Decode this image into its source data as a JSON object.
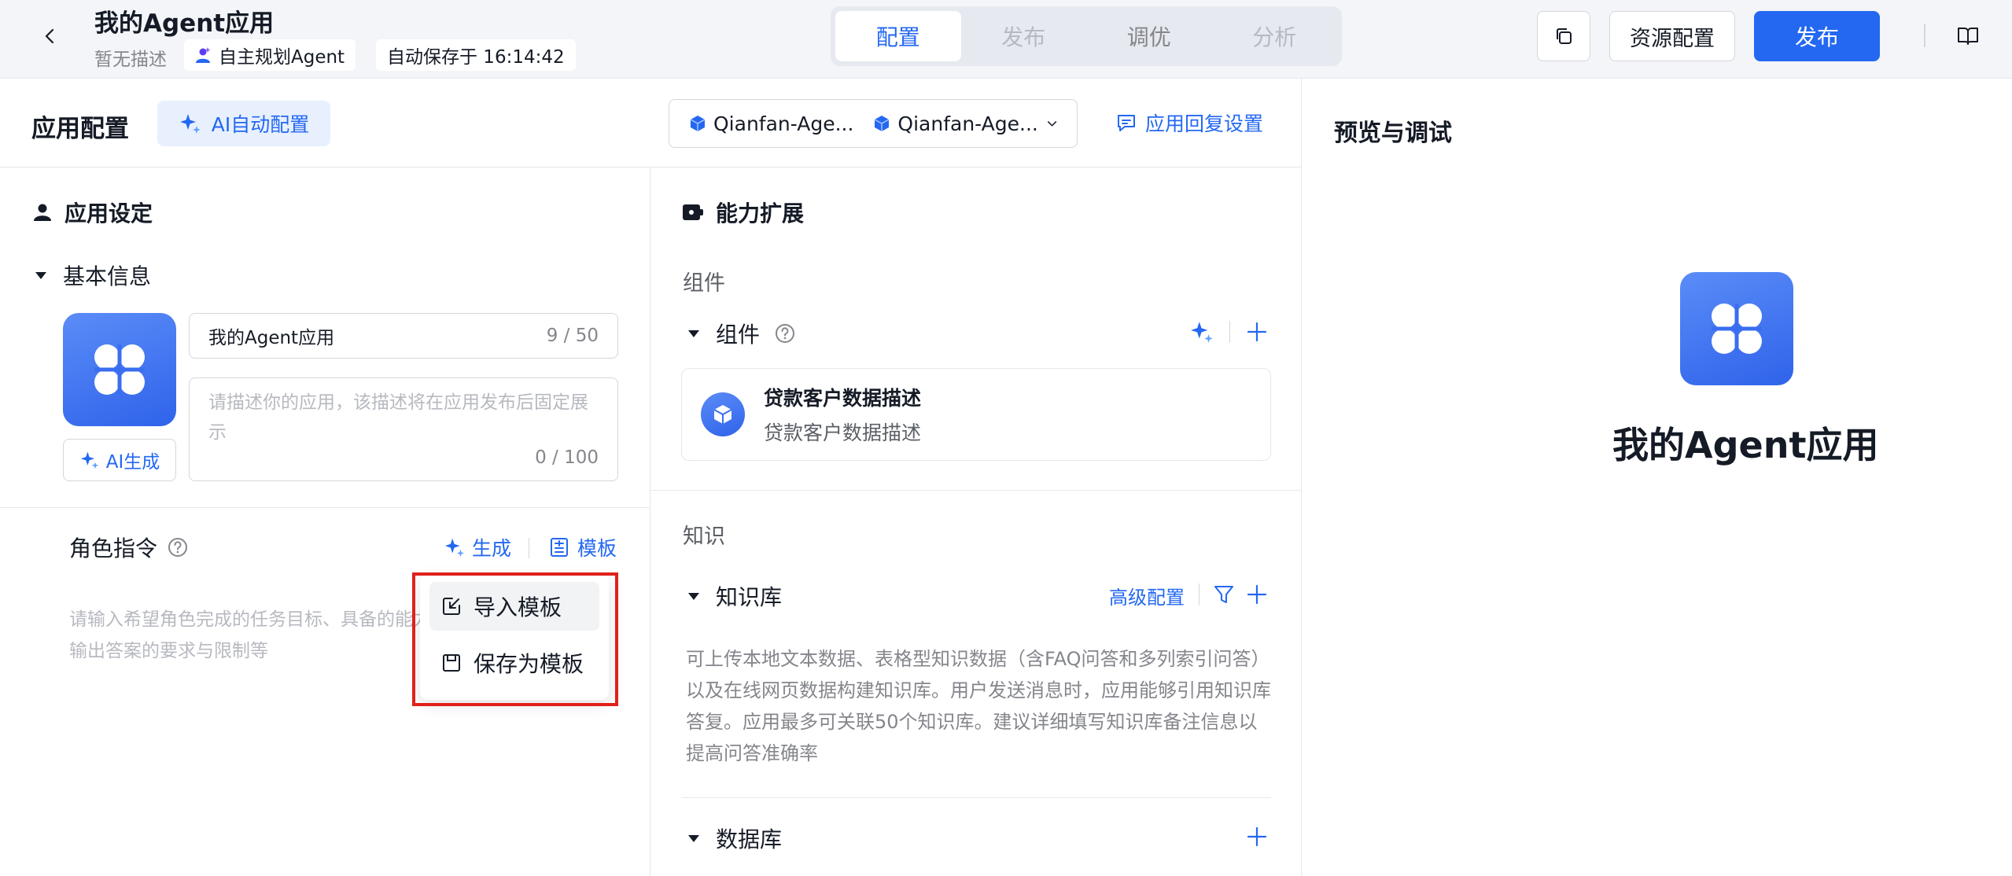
{
  "header": {
    "title": "我的Agent应用",
    "description": "暂无描述",
    "agent_type": "自主规划Agent",
    "autosave": "自动保存于 16:14:42",
    "tabs": [
      {
        "label": "配置",
        "state": "active"
      },
      {
        "label": "发布",
        "state": "disabled"
      },
      {
        "label": "调优",
        "state": "normal"
      },
      {
        "label": "分析",
        "state": "disabled"
      }
    ],
    "resource_config_label": "资源配置",
    "publish_label": "发布"
  },
  "config_bar": {
    "title": "应用配置",
    "ai_auto_label": "AI自动配置",
    "models": [
      "Qianfan-Age...",
      "Qianfan-Age..."
    ],
    "reply_settings_label": "应用回复设置"
  },
  "app_settings": {
    "section_title": "应用设定",
    "basic_info_label": "基本信息",
    "ai_generate_label": "AI生成",
    "name_value": "我的Agent应用",
    "name_count": "9 / 50",
    "desc_placeholder": "请描述你的应用，该描述将在应用发布后固定展示",
    "desc_count": "0 / 100",
    "role_label": "角色指令",
    "generate_label": "生成",
    "template_label": "模板",
    "role_placeholder": "请输入希望角色完成的任务目标、具备的能力及对输出答案的要求与限制等"
  },
  "template_menu": {
    "items": [
      {
        "label": "导入模板",
        "icon": "import-icon"
      },
      {
        "label": "保存为模板",
        "icon": "save-icon"
      }
    ]
  },
  "capabilities": {
    "section_title": "能力扩展",
    "component_group": "组件",
    "component_label": "组件",
    "component_card": {
      "title": "贷款客户数据描述",
      "description": "贷款客户数据描述"
    },
    "knowledge_group": "知识",
    "kb_label": "知识库",
    "advanced_config": "高级配置",
    "kb_description": "可上传本地文本数据、表格型知识数据（含FAQ问答和多列索引问答）以及在线网页数据构建知识库。用户发送消息时，应用能够引用知识库答复。应用最多可关联50个知识库。建议详细填写知识库备注信息以提高问答准确率",
    "database_label": "数据库"
  },
  "preview": {
    "title": "预览与调试",
    "app_name": "我的Agent应用"
  },
  "colors": {
    "accent": "#2468f2",
    "highlight_border": "#e0201a",
    "header_bg": "#f3f5f8"
  }
}
